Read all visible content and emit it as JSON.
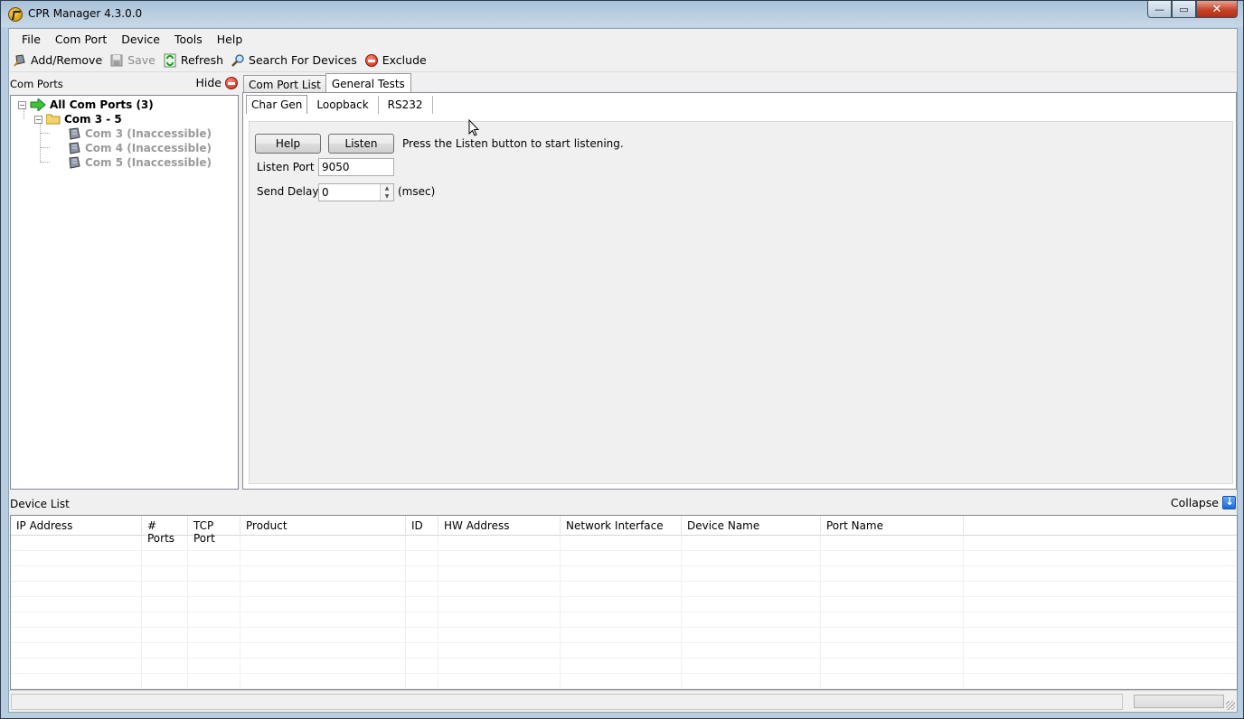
{
  "window": {
    "title": "CPR Manager 4.3.0.0",
    "controls": {
      "minimize": "—",
      "maximize": "▭",
      "close": "✕"
    }
  },
  "menu": [
    "File",
    "Com Port",
    "Device",
    "Tools",
    "Help"
  ],
  "toolbar": {
    "add_remove": "Add/Remove",
    "save": "Save",
    "refresh": "Refresh",
    "search": "Search For Devices",
    "exclude": "Exclude"
  },
  "left_pane": {
    "title": "Com Ports",
    "hide_label": "Hide",
    "tree": {
      "root": "All Com Ports (3)",
      "group": "Com 3 - 5",
      "ports": [
        "Com 3 (Inaccessible)",
        "Com 4 (Inaccessible)",
        "Com 5 (Inaccessible)"
      ]
    }
  },
  "main_tabs": [
    "Com Port List",
    "General Tests"
  ],
  "sub_tabs": [
    "Char Gen",
    "Loopback",
    "RS232"
  ],
  "chargen": {
    "help_button": "Help",
    "listen_button": "Listen",
    "status_message": "Press the Listen button to start listening.",
    "listen_port_label": "Listen Port",
    "listen_port_value": "9050",
    "send_delay_label": "Send Delay",
    "send_delay_value": "0",
    "send_delay_unit": "(msec)"
  },
  "device_list": {
    "title": "Device List",
    "collapse_label": "Collapse",
    "columns": [
      "IP Address",
      "# Ports",
      "TCP Port",
      "Product",
      "ID",
      "HW Address",
      "Network Interface",
      "Device Name",
      "Port Name"
    ]
  },
  "status_bar": {
    "text": ""
  },
  "colors": {
    "accent_blue": "#1d6ad8",
    "stop_red": "#d3220e",
    "title_gradient": "#a9c2d8",
    "disabled_text": "#9a9a9a"
  }
}
